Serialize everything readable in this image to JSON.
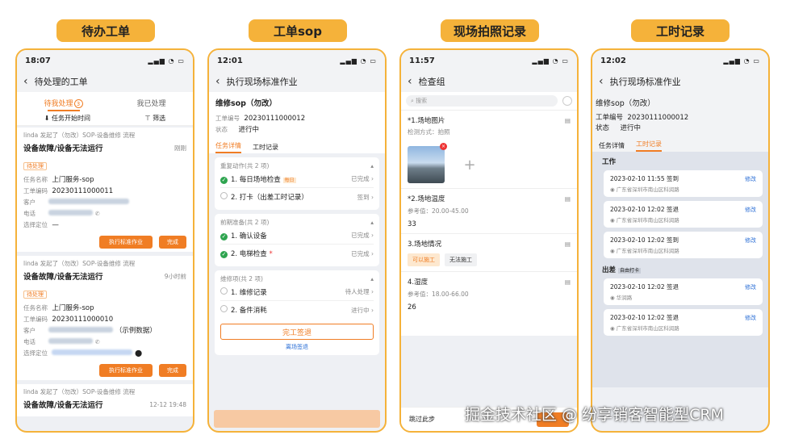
{
  "labels": [
    "待办工单",
    "工单sop",
    "现场拍照记录",
    "工时记录"
  ],
  "watermark": "掘金技术社区 @ 纷享销客智能型CRM",
  "p1": {
    "time": "18:07",
    "title": "待处理的工单",
    "tab1": "待我处理",
    "tab1_count": "3",
    "tab2": "我已处理",
    "filter1": "任务开始时间",
    "filter2": "筛选",
    "orders": [
      {
        "meta": "linda 发起了（勿改）SOP-设备维修 流程",
        "title": "设备故障/设备无法运行",
        "time": "刚刚",
        "badge": "待处理",
        "task": "上门服务-sop",
        "no": "20230111000011",
        "btn1": "执行标准作业",
        "btn2": "完成"
      },
      {
        "meta": "linda 发起了（勿改）SOP-设备维修 流程",
        "title": "设备故障/设备无法运行",
        "time": "9小时前",
        "badge": "待处理",
        "task": "上门服务-sop",
        "no": "20230111000010",
        "extra": "（示例数据）",
        "btn1": "执行标准作业",
        "btn2": "完成"
      },
      {
        "meta": "linda 发起了（勿改）SOP-设备维修 流程",
        "title": "设备故障/设备无法运行",
        "time": "12-12 19:48"
      }
    ],
    "lbl_task": "任务名称",
    "lbl_no": "工单编码",
    "lbl_cust": "客户",
    "lbl_phone": "电话",
    "lbl_loc": "选择定位",
    "loc_val": "—"
  },
  "p2": {
    "time": "12:01",
    "title": "执行现场标准作业",
    "name": "维修sop（勿改）",
    "lbl_no": "工单编号",
    "no": "20230111000012",
    "lbl_status": "状态",
    "status": "进行中",
    "tab1": "任务详情",
    "tab2": "工时记录",
    "g1": "重复动作(共 2 项)",
    "g1i1": "1. 每日场地检查",
    "g1i1tag": "每日",
    "g1i1s": "已完成",
    "g1i2": "2. 打卡（出差工时记录）",
    "g1i2s": "签到",
    "g2": "前期准备(共 2 项)",
    "g2i1": "1. 确认设备",
    "g2i1s": "已完成",
    "g2i2": "2. 电梯检查",
    "g2i2s": "已完成",
    "g3": "维修项(共 2 项)",
    "g3i1": "1. 维修记录",
    "g3i1s": "待人处理",
    "g3i2": "2. 备件消耗",
    "g3i2s": "进行中",
    "btn": "完工签退",
    "link": "离场签退"
  },
  "p3": {
    "time": "11:57",
    "title": "检查组",
    "search": "搜索",
    "q1": "*1.场地图片",
    "q1sub": "检测方式：拍照",
    "q2": "*2.场地温度",
    "q2ref": "参考值：20.00-45.00",
    "q2val": "33",
    "q3": "3.场地情况",
    "q3a": "可以施工",
    "q3b": "无法施工",
    "q4": "4.湿度",
    "q4ref": "参考值：18.00-66.00",
    "q4val": "26",
    "skip": "跳过此步"
  },
  "p4": {
    "time": "12:02",
    "title": "执行现场标准作业",
    "name": "维修sop（勿改）",
    "lbl_no": "工单编号",
    "no": "20230111000012",
    "lbl_status": "状态",
    "status": "进行中",
    "tab1": "任务详情",
    "tab2": "工时记录",
    "sec1": "工作",
    "sec2": "出差",
    "sec2tag": "自由打卡",
    "edit": "修改",
    "recs1": [
      {
        "t": "2023-02-10 11:55  签到",
        "a": "广东省深圳市南山区科润路"
      },
      {
        "t": "2023-02-10 12:02  签退",
        "a": "广东省深圳市南山区科润路"
      },
      {
        "t": "2023-02-10 12:02  签到",
        "a": "广东省深圳市南山区科润路"
      }
    ],
    "recs2": [
      {
        "t": "2023-02-10 12:02  签退",
        "a": "华润路"
      },
      {
        "t": "2023-02-10 12:02  签退",
        "a": "广东省深圳市南山区科润路"
      }
    ]
  },
  "colors": {
    "accent": "#f5b23a",
    "orange": "#f07d24",
    "green": "#2ea44f",
    "blue": "#2b6fd6"
  }
}
